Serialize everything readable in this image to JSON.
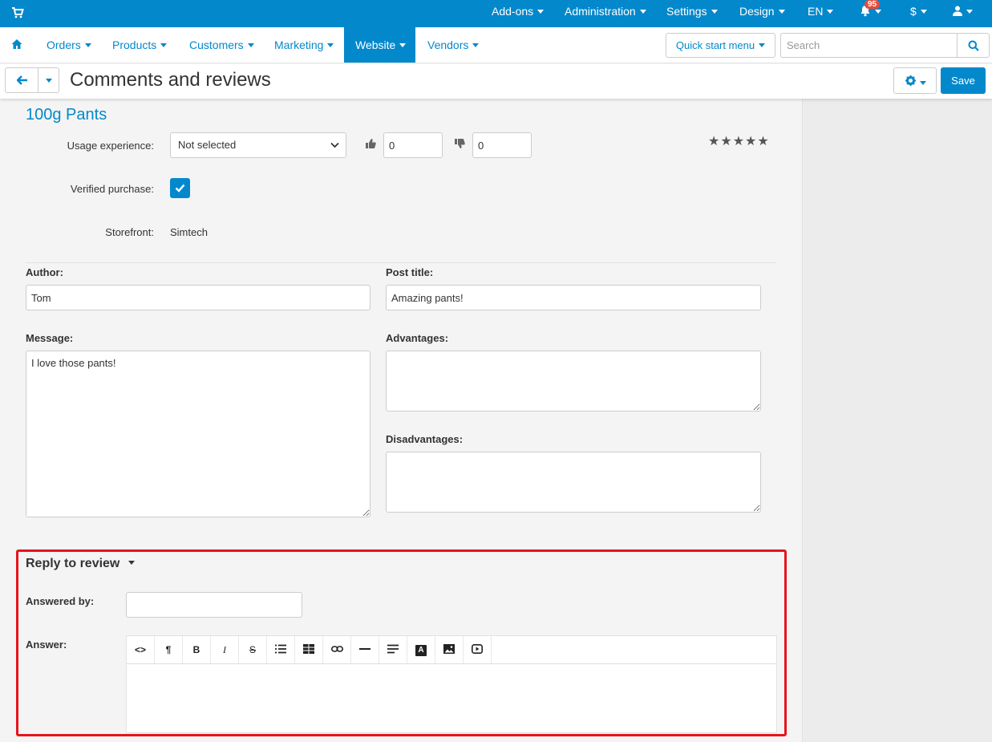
{
  "topbar": {
    "menus": [
      {
        "label": "Add-ons"
      },
      {
        "label": "Administration"
      },
      {
        "label": "Settings"
      },
      {
        "label": "Design"
      },
      {
        "label": "EN"
      }
    ],
    "notifications_count": "95",
    "currency": "$"
  },
  "navbar": {
    "items": [
      {
        "label": "Orders"
      },
      {
        "label": "Products"
      },
      {
        "label": "Customers"
      },
      {
        "label": "Marketing"
      },
      {
        "label": "Website",
        "active": true
      },
      {
        "label": "Vendors"
      }
    ],
    "quick_start": "Quick start menu",
    "search_placeholder": "Search"
  },
  "titlebar": {
    "title": "Comments and reviews",
    "save_label": "Save"
  },
  "review": {
    "product_name": "100g Pants",
    "usage_experience_label": "Usage experience:",
    "usage_experience_value": "Not selected",
    "helpful_count": "0",
    "not_helpful_count": "0",
    "rating_stars": "★★★★★",
    "verified_purchase_label": "Verified purchase:",
    "verified_purchase_checked": true,
    "storefront_label": "Storefront:",
    "storefront_value": "Simtech",
    "author_label": "Author:",
    "author_value": "Tom",
    "post_title_label": "Post title:",
    "post_title_value": "Amazing pants!",
    "message_label": "Message:",
    "message_value": "I love those pants!",
    "advantages_label": "Advantages:",
    "advantages_value": "",
    "disadvantages_label": "Disadvantages:",
    "disadvantages_value": ""
  },
  "reply": {
    "title": "Reply to review",
    "answered_by_label": "Answered by:",
    "answered_by_value": "",
    "answer_label": "Answer:",
    "toolbar_buttons": [
      {
        "name": "code-view",
        "glyph": "<>"
      },
      {
        "name": "paragraph",
        "glyph": "¶"
      },
      {
        "name": "bold",
        "glyph": "B"
      },
      {
        "name": "italic",
        "glyph": "I"
      },
      {
        "name": "strikethrough",
        "glyph": "S"
      },
      {
        "name": "list",
        "glyph": ""
      },
      {
        "name": "table",
        "glyph": ""
      },
      {
        "name": "link",
        "glyph": ""
      },
      {
        "name": "horizontal-rule",
        "glyph": ""
      },
      {
        "name": "align",
        "glyph": ""
      },
      {
        "name": "font-color",
        "glyph": "A"
      },
      {
        "name": "image",
        "glyph": ""
      },
      {
        "name": "video",
        "glyph": ""
      }
    ]
  },
  "colors": {
    "brand": "#0388cc",
    "highlight": "#e8141b",
    "badge": "#e74c3c"
  }
}
